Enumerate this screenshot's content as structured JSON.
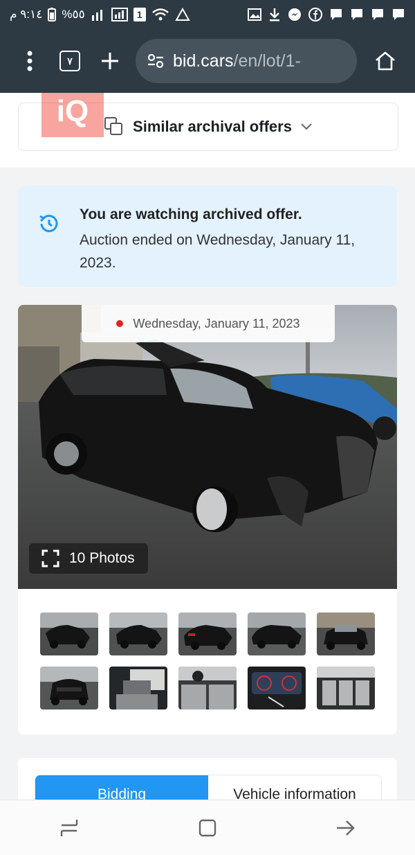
{
  "status_bar": {
    "time": "٩:١٤ م",
    "battery": "%٥٥",
    "sim": "1"
  },
  "browser": {
    "tab_count": "٧",
    "url_host": "bid.cars",
    "url_path": "/en/lot/1-"
  },
  "similar": {
    "label": "Similar archival offers"
  },
  "watermark": {
    "text": "iQ"
  },
  "notice": {
    "title": "You are watching archived offer.",
    "body": "Auction ended on Wednesday, January 11, 2023."
  },
  "gallery": {
    "date": "Wednesday, January 11, 2023",
    "photos_label": "10 Photos",
    "thumbnails": [
      "exterior-left-front",
      "exterior-side",
      "exterior-rear-left",
      "exterior-right",
      "exterior-front",
      "exterior-rear",
      "interior-driver-seat",
      "interior-dashboard",
      "instrument-cluster",
      "interior-rear-seats"
    ]
  },
  "tabs": {
    "bidding": "Bidding",
    "vehicle_info": "Vehicle information"
  },
  "colors": {
    "chrome": "#2d3a44",
    "accent": "#2196f3",
    "notice_bg": "#e3f2fd",
    "dot": "#e02424"
  }
}
